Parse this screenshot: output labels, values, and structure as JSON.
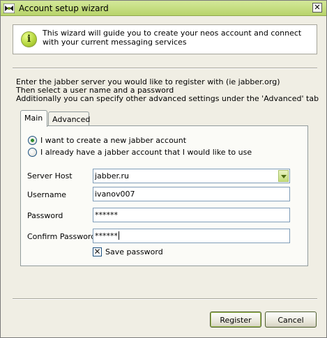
{
  "window": {
    "title": "Account setup wizard",
    "close_label": "✕",
    "app_icon": "jabber-bulb-icon"
  },
  "info": {
    "icon": "info-icon",
    "icon_glyph": "i",
    "line1": "This wizard will guide you to create your neos account and connect",
    "line2": "with your current messaging services"
  },
  "instructions": {
    "line1": "Enter the jabber server you would like to register with (ie jabber.org)",
    "line2": "Then select a user name and a password",
    "line3": "Additionally you can specify other advanced settings under the 'Advanced' tab"
  },
  "tabs": [
    {
      "label": "Main",
      "active": true
    },
    {
      "label": "Advanced",
      "active": false
    }
  ],
  "form": {
    "radio_new": {
      "label": "I want to create a new jabber account",
      "checked": true
    },
    "radio_existing": {
      "label": "I already have a jabber account that I would like to use",
      "checked": false
    },
    "server_host": {
      "label": "Server Host",
      "value": "jabber.ru"
    },
    "username": {
      "label": "Username",
      "value": "ivanov007"
    },
    "password": {
      "label": "Password",
      "value": "******"
    },
    "confirm_password": {
      "label": "Confirm Password",
      "value": "******"
    },
    "save_password": {
      "label": "Save password",
      "checked": true,
      "mark": "✕"
    }
  },
  "buttons": {
    "register": "Register",
    "cancel": "Cancel"
  },
  "colors": {
    "titlebar": "#c4dd7a",
    "accent": "#a4c25a"
  }
}
